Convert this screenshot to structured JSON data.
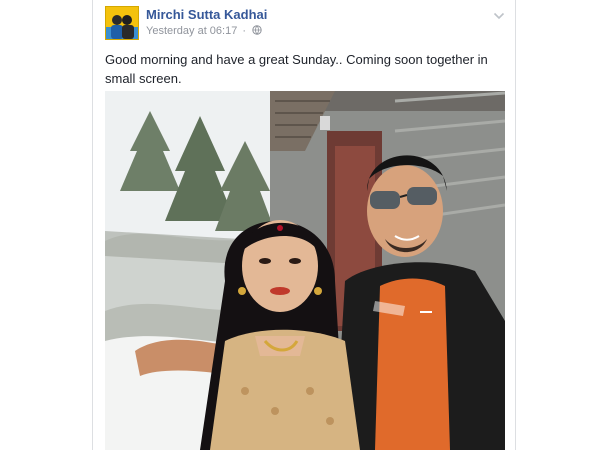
{
  "post": {
    "author": "Mirchi Sutta Kadhai",
    "timestamp": "Yesterday at 06:17",
    "separator": "·",
    "body_text": "Good morning and have a great Sunday.. Coming soon together in small screen.",
    "privacy_icon": "globe-icon",
    "menu_icon": "chevron-down-icon",
    "image": "selfie-photo"
  },
  "colors": {
    "author_link": "#365899",
    "meta_text": "#90949c",
    "body_text": "#1d2129",
    "card_border": "#dddfe2"
  }
}
